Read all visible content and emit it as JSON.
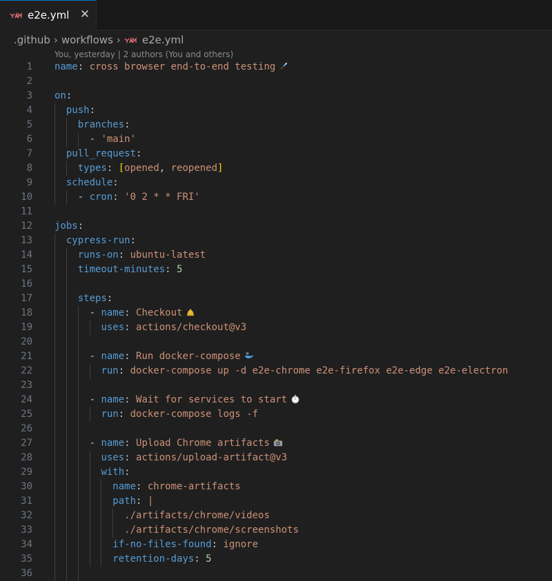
{
  "tab": {
    "label": "e2e.yml",
    "close": "✕"
  },
  "breadcrumb": [
    ".github",
    "workflows",
    "e2e.yml"
  ],
  "codelens": "You, yesterday | 2 authors (You and others)",
  "lines": [
    {
      "n": "1",
      "indent": 0,
      "tokens": [
        [
          "k",
          "name"
        ],
        [
          "p",
          ": "
        ],
        [
          "s",
          "cross browser end-to-end testing"
        ]
      ],
      "emoji": "rocket"
    },
    {
      "n": "2",
      "indent": 0,
      "tokens": []
    },
    {
      "n": "3",
      "indent": 0,
      "tokens": [
        [
          "k",
          "on"
        ],
        [
          "p",
          ":"
        ]
      ]
    },
    {
      "n": "4",
      "indent": 1,
      "tokens": [
        [
          "k",
          "push"
        ],
        [
          "p",
          ":"
        ]
      ]
    },
    {
      "n": "5",
      "indent": 2,
      "tokens": [
        [
          "k",
          "branches"
        ],
        [
          "p",
          ":"
        ]
      ]
    },
    {
      "n": "6",
      "indent": 3,
      "tokens": [
        [
          "p",
          "- "
        ],
        [
          "s",
          "'main'"
        ]
      ]
    },
    {
      "n": "7",
      "indent": 1,
      "tokens": [
        [
          "k",
          "pull_request"
        ],
        [
          "p",
          ":"
        ]
      ]
    },
    {
      "n": "8",
      "indent": 2,
      "tokens": [
        [
          "k",
          "types"
        ],
        [
          "p",
          ": "
        ],
        [
          "b",
          "["
        ],
        [
          "s",
          "opened"
        ],
        [
          "p",
          ", "
        ],
        [
          "s",
          "reopened"
        ],
        [
          "b",
          "]"
        ]
      ]
    },
    {
      "n": "9",
      "indent": 1,
      "tokens": [
        [
          "k",
          "schedule"
        ],
        [
          "p",
          ":"
        ]
      ]
    },
    {
      "n": "10",
      "indent": 2,
      "tokens": [
        [
          "p",
          "- "
        ],
        [
          "k",
          "cron"
        ],
        [
          "p",
          ": "
        ],
        [
          "s",
          "'0 2 * * FRI'"
        ]
      ]
    },
    {
      "n": "11",
      "indent": 0,
      "tokens": []
    },
    {
      "n": "12",
      "indent": 0,
      "tokens": [
        [
          "k",
          "jobs"
        ],
        [
          "p",
          ":"
        ]
      ]
    },
    {
      "n": "13",
      "indent": 1,
      "tokens": [
        [
          "k",
          "cypress-run"
        ],
        [
          "p",
          ":"
        ]
      ]
    },
    {
      "n": "14",
      "indent": 2,
      "tokens": [
        [
          "k",
          "runs-on"
        ],
        [
          "p",
          ": "
        ],
        [
          "s",
          "ubuntu-latest"
        ]
      ]
    },
    {
      "n": "15",
      "indent": 2,
      "tokens": [
        [
          "k",
          "timeout-minutes"
        ],
        [
          "p",
          ": "
        ],
        [
          "n",
          "5"
        ]
      ]
    },
    {
      "n": "16",
      "indent": 0,
      "guides": 2,
      "tokens": []
    },
    {
      "n": "17",
      "indent": 2,
      "tokens": [
        [
          "k",
          "steps"
        ],
        [
          "p",
          ":"
        ]
      ]
    },
    {
      "n": "18",
      "indent": 3,
      "tokens": [
        [
          "p",
          "- "
        ],
        [
          "k",
          "name"
        ],
        [
          "p",
          ": "
        ],
        [
          "s",
          "Checkout"
        ]
      ],
      "emoji": "bell"
    },
    {
      "n": "19",
      "indent": 4,
      "tokens": [
        [
          "k",
          "uses"
        ],
        [
          "p",
          ": "
        ],
        [
          "s",
          "actions/checkout@v3"
        ]
      ]
    },
    {
      "n": "20",
      "indent": 0,
      "guides": 3,
      "tokens": []
    },
    {
      "n": "21",
      "indent": 3,
      "tokens": [
        [
          "p",
          "- "
        ],
        [
          "k",
          "name"
        ],
        [
          "p",
          ": "
        ],
        [
          "s",
          "Run docker-compose"
        ]
      ],
      "emoji": "whale"
    },
    {
      "n": "22",
      "indent": 4,
      "tokens": [
        [
          "k",
          "run"
        ],
        [
          "p",
          ": "
        ],
        [
          "s",
          "docker-compose up -d e2e-chrome e2e-firefox e2e-edge e2e-electron"
        ]
      ]
    },
    {
      "n": "23",
      "indent": 0,
      "guides": 3,
      "tokens": []
    },
    {
      "n": "24",
      "indent": 3,
      "tokens": [
        [
          "p",
          "- "
        ],
        [
          "k",
          "name"
        ],
        [
          "p",
          ": "
        ],
        [
          "s",
          "Wait for services to start"
        ]
      ],
      "emoji": "stopwatch"
    },
    {
      "n": "25",
      "indent": 4,
      "tokens": [
        [
          "k",
          "run"
        ],
        [
          "p",
          ": "
        ],
        [
          "s",
          "docker-compose logs -f"
        ]
      ]
    },
    {
      "n": "26",
      "indent": 0,
      "guides": 3,
      "tokens": []
    },
    {
      "n": "27",
      "indent": 3,
      "tokens": [
        [
          "p",
          "- "
        ],
        [
          "k",
          "name"
        ],
        [
          "p",
          ": "
        ],
        [
          "s",
          "Upload Chrome artifacts"
        ]
      ],
      "emoji": "camera"
    },
    {
      "n": "28",
      "indent": 4,
      "tokens": [
        [
          "k",
          "uses"
        ],
        [
          "p",
          ": "
        ],
        [
          "s",
          "actions/upload-artifact@v3"
        ]
      ]
    },
    {
      "n": "29",
      "indent": 4,
      "tokens": [
        [
          "k",
          "with"
        ],
        [
          "p",
          ":"
        ]
      ]
    },
    {
      "n": "30",
      "indent": 5,
      "tokens": [
        [
          "k",
          "name"
        ],
        [
          "p",
          ": "
        ],
        [
          "s",
          "chrome-artifacts"
        ]
      ]
    },
    {
      "n": "31",
      "indent": 5,
      "tokens": [
        [
          "k",
          "path"
        ],
        [
          "p",
          ": "
        ],
        [
          "s",
          "|"
        ]
      ]
    },
    {
      "n": "32",
      "indent": 6,
      "tokens": [
        [
          "s",
          "./artifacts/chrome/videos"
        ]
      ]
    },
    {
      "n": "33",
      "indent": 6,
      "tokens": [
        [
          "s",
          "./artifacts/chrome/screenshots"
        ]
      ]
    },
    {
      "n": "34",
      "indent": 5,
      "tokens": [
        [
          "k",
          "if-no-files-found"
        ],
        [
          "p",
          ": "
        ],
        [
          "s",
          "ignore"
        ]
      ]
    },
    {
      "n": "35",
      "indent": 5,
      "tokens": [
        [
          "k",
          "retention-days"
        ],
        [
          "p",
          ": "
        ],
        [
          "n",
          "5"
        ]
      ]
    },
    {
      "n": "36",
      "indent": 0,
      "guides": 3,
      "tokens": []
    }
  ]
}
